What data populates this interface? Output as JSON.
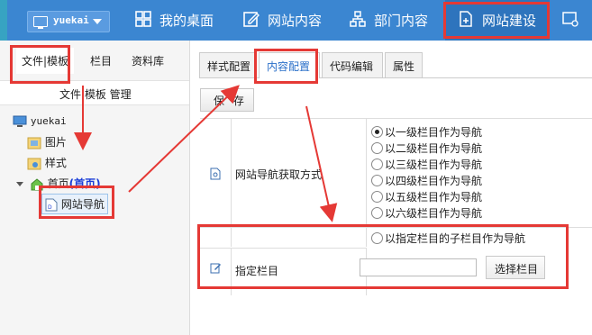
{
  "topbar": {
    "site_name": "yuekai",
    "nav": [
      {
        "label": "我的桌面",
        "icon": "grid-icon"
      },
      {
        "label": "网站内容",
        "icon": "edit-icon"
      },
      {
        "label": "部门内容",
        "icon": "org-chart-icon"
      },
      {
        "label": "网站建设",
        "icon": "add-page-icon"
      }
    ]
  },
  "sidebar": {
    "tabs": [
      "文件|模板",
      "栏目",
      "资料库"
    ],
    "header": "文件 模板 管理",
    "tree": {
      "root": "yuekai",
      "children": [
        "图片",
        "样式"
      ],
      "home_label": "首页",
      "home_tag": "(首页)",
      "selected": "网站导航"
    }
  },
  "main": {
    "tabs": [
      "样式配置",
      "内容配置",
      "代码编辑",
      "属性"
    ],
    "active_tab": "内容配置",
    "save_label": "保 存",
    "nav_source_label": "网站导航获取方式",
    "radio_options": [
      "以一级栏目作为导航",
      "以二级栏目作为导航",
      "以三级栏目作为导航",
      "以四级栏目作为导航",
      "以五级栏目作为导航",
      "以六级栏目作为导航",
      "以指定栏目的子栏目作为导航"
    ],
    "selected_option": "以一级栏目作为导航",
    "column_label": "指定栏目",
    "column_value": "",
    "select_column_label": "选择栏目"
  },
  "colors": {
    "topbar": "#3b86d1",
    "annotation": "#e53935",
    "accent_text": "#2a6fc9"
  }
}
